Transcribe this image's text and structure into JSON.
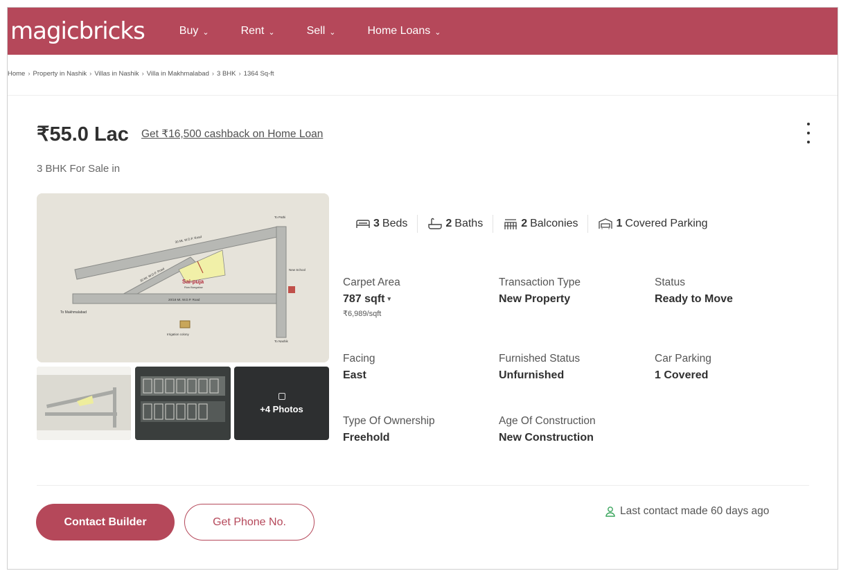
{
  "brand": {
    "logo_text": "magicbricks",
    "primary_color": "#b5485a"
  },
  "nav": {
    "items": [
      {
        "label": "Buy"
      },
      {
        "label": "Rent"
      },
      {
        "label": "Sell"
      },
      {
        "label": "Home Loans"
      }
    ]
  },
  "breadcrumb": [
    "Home",
    "Property in Nashik",
    "Villas in Nashik",
    "Villa in Makhmalabad",
    "3 BHK",
    "1364 Sq-ft"
  ],
  "listing": {
    "price": "₹55.0 Lac",
    "cashback_link": "Get ₹16,500 cashback on Home Loan",
    "subtitle": "3 BHK For Sale in"
  },
  "gallery": {
    "map_labels": {
      "road_top": "30 Mt. W.D.P. Road",
      "road_mid": "30 Mt. W.D.P. Road",
      "road_lower": "20/18 Mt. W.D.P. Road",
      "project": "Sai-puja",
      "project_sub": "Row Bungalow",
      "to_makhmalabad": "To Makhmalabad",
      "to_nashik": "To Nashik",
      "to_pathi": "To Pathi",
      "irrigation": "Irrigation colony",
      "new_school": "New School"
    },
    "more_photos_label": "+4 Photos"
  },
  "amenities": [
    {
      "icon": "bed-icon",
      "value": "3",
      "label": "Beds"
    },
    {
      "icon": "bath-icon",
      "value": "2",
      "label": "Baths"
    },
    {
      "icon": "balcony-icon",
      "value": "2",
      "label": "Balconies"
    },
    {
      "icon": "car-icon",
      "value": "1",
      "label": "Covered Parking"
    }
  ],
  "details": {
    "carpet_area": {
      "label": "Carpet Area",
      "value": "787 sqft",
      "sub": "₹6,989/sqft"
    },
    "transaction_type": {
      "label": "Transaction Type",
      "value": "New Property"
    },
    "status": {
      "label": "Status",
      "value": "Ready to Move"
    },
    "facing": {
      "label": "Facing",
      "value": "East"
    },
    "furnished_status": {
      "label": "Furnished Status",
      "value": "Unfurnished"
    },
    "car_parking": {
      "label": "Car Parking",
      "value": "1 Covered"
    },
    "ownership": {
      "label": "Type Of Ownership",
      "value": "Freehold"
    },
    "age": {
      "label": "Age Of Construction",
      "value": "New Construction"
    }
  },
  "actions": {
    "contact_builder": "Contact Builder",
    "get_phone": "Get Phone No.",
    "last_contact": "Last contact made 60 days ago"
  }
}
